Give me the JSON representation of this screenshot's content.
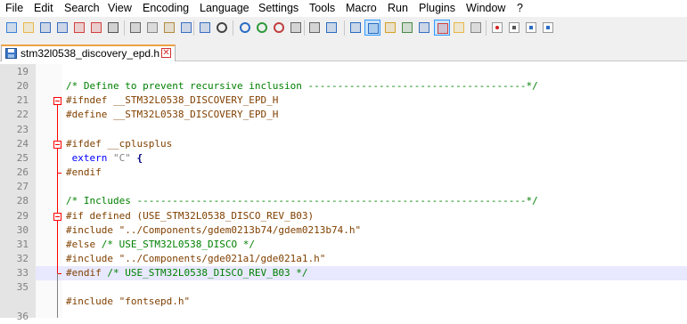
{
  "menu": [
    "File",
    "Edit",
    "Search",
    "View",
    "Encoding",
    "Language",
    "Settings",
    "Tools",
    "Macro",
    "Run",
    "Plugins",
    "Window",
    "?"
  ],
  "toolbar_icons": [
    "new-file-icon",
    "open-file-icon",
    "save-icon",
    "save-all-icon",
    "close-icon",
    "close-all-icon",
    "print-icon",
    "cut-icon",
    "copy-icon",
    "paste-icon",
    "undo-icon",
    "redo-icon",
    "find-icon",
    "replace-icon",
    "zoom-in-icon",
    "zoom-out-icon",
    "sync-vertical-icon",
    "sync-horizontal-icon",
    "word-wrap-icon",
    "show-all-characters-icon",
    "indent-guide-icon",
    "user-language-icon",
    "document-map-icon",
    "function-list-icon",
    "folder-as-workspace-icon",
    "doc-list-icon",
    "monitoring-icon",
    "record-macro-icon",
    "stop-recording-icon",
    "playback-macro-icon",
    "run-macro-multiple-icon"
  ],
  "tab": {
    "label": "stm32l0538_discovery_epd.h",
    "close": "✕"
  },
  "editor": {
    "current_line": "33",
    "lines": [
      {
        "n": "19",
        "t": []
      },
      {
        "n": "20",
        "t": [
          [
            "c",
            "/* Define to prevent recursive inclusion -------------------------------------*/"
          ]
        ]
      },
      {
        "n": "21",
        "t": [
          [
            "p",
            "#ifndef __STM32L0538_DISCOVERY_EPD_H"
          ]
        ]
      },
      {
        "n": "22",
        "t": [
          [
            "p",
            "#define __STM32L0538_DISCOVERY_EPD_H"
          ]
        ]
      },
      {
        "n": "23",
        "t": []
      },
      {
        "n": "24",
        "t": [
          [
            "p",
            "#ifdef __cplusplus"
          ]
        ]
      },
      {
        "n": "25",
        "t": [
          [
            "k",
            " extern "
          ],
          [
            "s",
            "\"C\""
          ],
          [
            "o",
            " {"
          ]
        ]
      },
      {
        "n": "26",
        "t": [
          [
            "p",
            "#endif"
          ]
        ]
      },
      {
        "n": "27",
        "t": []
      },
      {
        "n": "28",
        "t": [
          [
            "c",
            "/* Includes ------------------------------------------------------------------*/"
          ]
        ]
      },
      {
        "n": "29",
        "t": [
          [
            "p",
            "#if defined (USE_STM32L0538_DISCO_REV_B03)"
          ]
        ]
      },
      {
        "n": "30",
        "t": [
          [
            "p",
            "#include \"../Components/gdem0213b74/gdem0213b74.h\""
          ]
        ]
      },
      {
        "n": "31",
        "t": [
          [
            "p",
            "#else "
          ],
          [
            "c",
            "/* USE_STM32L0538_DISCO */"
          ]
        ]
      },
      {
        "n": "32",
        "t": [
          [
            "p",
            "#include \"../Components/gde021a1/gde021a1.h\""
          ]
        ]
      },
      {
        "n": "33",
        "t": [
          [
            "p",
            "#endif "
          ],
          [
            "c",
            "/* USE_STM32L0538_DISCO_REV_B03 */"
          ]
        ]
      },
      {
        "n": "35",
        "t": []
      },
      {
        "n": "",
        "t": [
          [
            "p",
            "#include \"fontsepd.h\""
          ]
        ]
      },
      {
        "n": "36",
        "t": []
      }
    ]
  }
}
